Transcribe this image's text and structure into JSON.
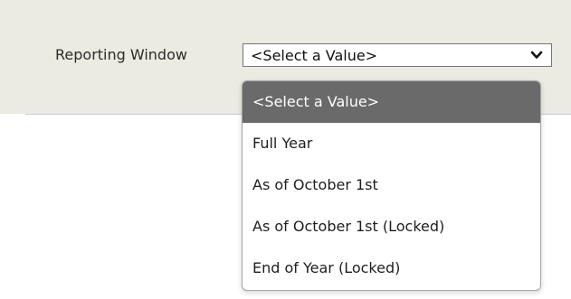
{
  "parameter": {
    "label": "Reporting Window",
    "selected_value": "<Select a Value>"
  },
  "dropdown": {
    "options": [
      {
        "label": "<Select a Value>",
        "selected": true
      },
      {
        "label": "Full Year",
        "selected": false
      },
      {
        "label": "As of October 1st",
        "selected": false
      },
      {
        "label": "As of October 1st (Locked)",
        "selected": false
      },
      {
        "label": "End of Year (Locked)",
        "selected": false
      }
    ]
  },
  "colors": {
    "param_background": "#ecebe1",
    "selected_option_background": "#6a6a6a",
    "selected_option_text": "#ffffff"
  },
  "icons": {
    "dropdown_arrow": "chevron-down-icon"
  }
}
